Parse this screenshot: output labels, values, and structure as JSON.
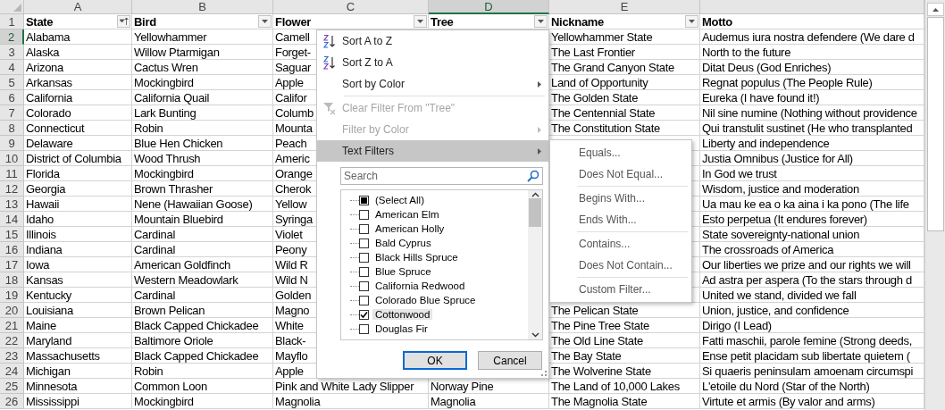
{
  "columns": [
    {
      "letter": "A",
      "selected": false
    },
    {
      "letter": "B",
      "selected": false
    },
    {
      "letter": "C",
      "selected": false
    },
    {
      "letter": "D",
      "selected": true
    },
    {
      "letter": "E",
      "selected": false
    },
    {}
  ],
  "header_row": {
    "number": "1",
    "selected": false,
    "cells": [
      {
        "text": "State",
        "filter_button": true,
        "sorted": true
      },
      {
        "text": "Bird",
        "filter_button": true,
        "sorted": false
      },
      {
        "text": "Flower",
        "filter_button": true,
        "sorted": false
      },
      {
        "text": "Tree",
        "filter_button": true,
        "sorted": false
      },
      {
        "text": "Nickname",
        "filter_button": true,
        "sorted": false
      },
      {
        "text": "Motto",
        "filter_button": false
      }
    ]
  },
  "rows": [
    {
      "number": "2",
      "selected": true,
      "cells": [
        "Alabama",
        "Yellowhammer",
        "Camell",
        null,
        "Yellowhammer State",
        "Audemus iura nostra defendere (We dare d"
      ]
    },
    {
      "number": "3",
      "selected": false,
      "cells": [
        "Alaska",
        "Willow Ptarmigan",
        "Forget-",
        null,
        "The Last Frontier",
        "North to the future"
      ]
    },
    {
      "number": "4",
      "selected": false,
      "cells": [
        "Arizona",
        "Cactus Wren",
        "Saguar",
        null,
        "The Grand Canyon State",
        "Ditat Deus (God Enriches)"
      ]
    },
    {
      "number": "5",
      "selected": false,
      "cells": [
        "Arkansas",
        "Mockingbird",
        "Apple",
        null,
        "Land of Opportunity",
        "Regnat populus (The People Rule)"
      ]
    },
    {
      "number": "6",
      "selected": false,
      "cells": [
        "California",
        "California Quail",
        "Califor",
        null,
        "The Golden State",
        "Eureka (I have found it!)"
      ]
    },
    {
      "number": "7",
      "selected": false,
      "cells": [
        "Colorado",
        "Lark Bunting",
        "Columb",
        null,
        "The Centennial State",
        "Nil sine numine (Nothing without providence"
      ]
    },
    {
      "number": "8",
      "selected": false,
      "cells": [
        "Connecticut",
        "Robin",
        "Mounta",
        null,
        "The Constitution State",
        "Qui transtulit sustinet (He who transplanted"
      ]
    },
    {
      "number": "9",
      "selected": false,
      "cells": [
        "Delaware",
        "Blue Hen Chicken",
        "Peach",
        null,
        null,
        "Liberty and independence"
      ]
    },
    {
      "number": "10",
      "selected": false,
      "cells": [
        "District of Columbia",
        "Wood Thrush",
        "Americ",
        null,
        null,
        "Justia Omnibus (Justice for All)"
      ]
    },
    {
      "number": "11",
      "selected": false,
      "cells": [
        "Florida",
        "Mockingbird",
        "Orange",
        null,
        null,
        "In God we trust"
      ]
    },
    {
      "number": "12",
      "selected": false,
      "cells": [
        "Georgia",
        "Brown Thrasher",
        "Cherok",
        null,
        null,
        "Wisdom, justice and moderation"
      ]
    },
    {
      "number": "13",
      "selected": false,
      "cells": [
        "Hawaii",
        "Nene (Hawaiian Goose)",
        "Yellow",
        null,
        null,
        "Ua mau ke ea o ka aina i ka pono (The life"
      ]
    },
    {
      "number": "14",
      "selected": false,
      "cells": [
        "Idaho",
        "Mountain Bluebird",
        "Syringa",
        null,
        null,
        "Esto perpetua (It endures forever)"
      ]
    },
    {
      "number": "15",
      "selected": false,
      "cells": [
        "Illinois",
        "Cardinal",
        "Violet",
        null,
        null,
        "State sovereignty-national union"
      ]
    },
    {
      "number": "16",
      "selected": false,
      "cells": [
        "Indiana",
        "Cardinal",
        "Peony",
        null,
        null,
        "The crossroads of America"
      ]
    },
    {
      "number": "17",
      "selected": false,
      "cells": [
        "Iowa",
        "American Goldfinch",
        "Wild R",
        null,
        null,
        "Our liberties we prize and our rights we will"
      ]
    },
    {
      "number": "18",
      "selected": false,
      "cells": [
        "Kansas",
        "Western Meadowlark",
        "Wild N",
        null,
        null,
        "Ad astra per aspera (To the stars through d"
      ]
    },
    {
      "number": "19",
      "selected": false,
      "cells": [
        "Kentucky",
        "Cardinal",
        "Golden",
        null,
        null,
        "United we stand, divided we fall"
      ]
    },
    {
      "number": "20",
      "selected": false,
      "cells": [
        "Louisiana",
        "Brown Pelican",
        "Magno",
        null,
        "The Pelican State",
        "Union, justice, and confidence"
      ]
    },
    {
      "number": "21",
      "selected": false,
      "cells": [
        "Maine",
        "Black Capped Chickadee",
        "White",
        null,
        "The Pine Tree State",
        "Dirigo (I Lead)"
      ]
    },
    {
      "number": "22",
      "selected": false,
      "cells": [
        "Maryland",
        "Baltimore Oriole",
        "Black-",
        null,
        "The Old Line State",
        "Fatti maschii, parole femine (Strong deeds,"
      ]
    },
    {
      "number": "23",
      "selected": false,
      "cells": [
        "Massachusetts",
        "Black Capped Chickadee",
        "Mayflo",
        null,
        "The Bay State",
        "Ense petit placidam sub libertate quietem ("
      ]
    },
    {
      "number": "24",
      "selected": false,
      "cells": [
        "Michigan",
        "Robin",
        "Apple",
        null,
        "The Wolverine State",
        "Si quaeris peninsulam amoenam circumspi"
      ]
    },
    {
      "number": "25",
      "selected": false,
      "cells": [
        "Minnesota",
        "Common Loon",
        "Pink and White Lady Slipper",
        "Norway Pine",
        "The Land of 10,000 Lakes",
        "L'etoile du Nord (Star of the North)"
      ]
    },
    {
      "number": "26",
      "selected": false,
      "cells": [
        "Mississippi",
        "Mockingbird",
        "Magnolia",
        "Magnolia",
        "The Magnolia State",
        "Virtute et armis (By valor and arms)"
      ]
    }
  ],
  "filter_menu": {
    "items": [
      {
        "kind": "sort-ascending",
        "label": "Sort A to Z",
        "disabled": false,
        "highlighted": false,
        "submenu": false
      },
      {
        "kind": "sort-descending",
        "label": "Sort Z to A",
        "disabled": false,
        "highlighted": false,
        "submenu": false
      },
      {
        "kind": "plain",
        "label": "Sort by Color",
        "disabled": false,
        "highlighted": false,
        "submenu": true
      },
      {
        "kind": "separator"
      },
      {
        "kind": "clear-filter",
        "label": "Clear Filter From \"Tree\"",
        "disabled": true,
        "highlighted": false,
        "submenu": false
      },
      {
        "kind": "plain",
        "label": "Filter by Color",
        "disabled": true,
        "highlighted": false,
        "submenu": true
      },
      {
        "kind": "plain",
        "label": "Text Filters",
        "disabled": false,
        "highlighted": true,
        "submenu": true
      }
    ],
    "search": {
      "placeholder": "Search"
    },
    "values": [
      {
        "label": "(Select All)",
        "partial": true,
        "selected": false
      },
      {
        "label": "American Elm",
        "checked": false,
        "selected": false
      },
      {
        "label": "American Holly",
        "checked": false,
        "selected": false
      },
      {
        "label": "Bald Cyprus",
        "checked": false,
        "selected": false
      },
      {
        "label": "Black Hills Spruce",
        "checked": false,
        "selected": false
      },
      {
        "label": "Blue Spruce",
        "checked": false,
        "selected": false
      },
      {
        "label": "California Redwood",
        "checked": false,
        "selected": false
      },
      {
        "label": "Colorado Blue Spruce",
        "checked": false,
        "selected": false
      },
      {
        "label": "Cottonwood",
        "checked": true,
        "selected": true
      },
      {
        "label": "Douglas Fir",
        "checked": false,
        "selected": false
      }
    ],
    "buttons": [
      {
        "label": "OK",
        "default": true
      },
      {
        "label": "Cancel",
        "default": false
      }
    ]
  },
  "text_filters_submenu": [
    {
      "kind": "item",
      "label": "Equals..."
    },
    {
      "kind": "item",
      "label": "Does Not Equal..."
    },
    {
      "kind": "separator"
    },
    {
      "kind": "item",
      "label": "Begins With..."
    },
    {
      "kind": "item",
      "label": "Ends With..."
    },
    {
      "kind": "separator"
    },
    {
      "kind": "item",
      "label": "Contains..."
    },
    {
      "kind": "item",
      "label": "Does Not Contain..."
    },
    {
      "kind": "separator"
    },
    {
      "kind": "item",
      "label": "Custom Filter..."
    }
  ]
}
